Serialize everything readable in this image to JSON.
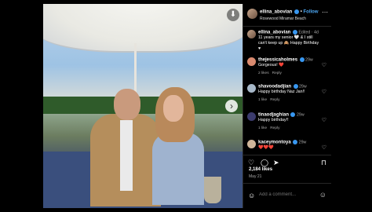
{
  "post": {
    "username": "ellina_abovian",
    "follow_label": "Follow",
    "location": "Rosewood Miramar Beach",
    "caption_username": "ellina_abovian",
    "caption_time": "Edited · 4d",
    "caption_text": "11 years my senior 🤍 & I still can't keep up 🙈 Happy Birthday ♥",
    "likes": "2,184 likes",
    "date": "May 21",
    "add_comment_placeholder": "Add a comment..."
  },
  "comments": [
    {
      "username": "thejessicaholmes",
      "time": "29w",
      "text": "Gorgeous! ❤️",
      "meta_likes": "2 likes",
      "reply": "Reply"
    },
    {
      "username": "shavoodadjian",
      "time": "29w",
      "text": "Happy birthday Naz Jan!!",
      "meta_likes": "1 like",
      "reply": "Reply"
    },
    {
      "username": "tinaodjaghian",
      "time": "29w",
      "text": "Happy birthday!!",
      "meta_likes": "1 like",
      "reply": "Reply"
    },
    {
      "username": "kaceymontoya",
      "time": "29w",
      "text": "❤️❤️❤️",
      "meta_likes": "",
      "reply": ""
    }
  ],
  "icons": {
    "more": "⋯",
    "like": "♡",
    "comment": "◯",
    "share": "➤",
    "save": "⊓",
    "emoji": "☺",
    "bookmark": "⬇",
    "next": "›"
  },
  "colors": {
    "link": "#4ea9f5",
    "verified": "#3897f0",
    "hearts": "#ed4956"
  }
}
